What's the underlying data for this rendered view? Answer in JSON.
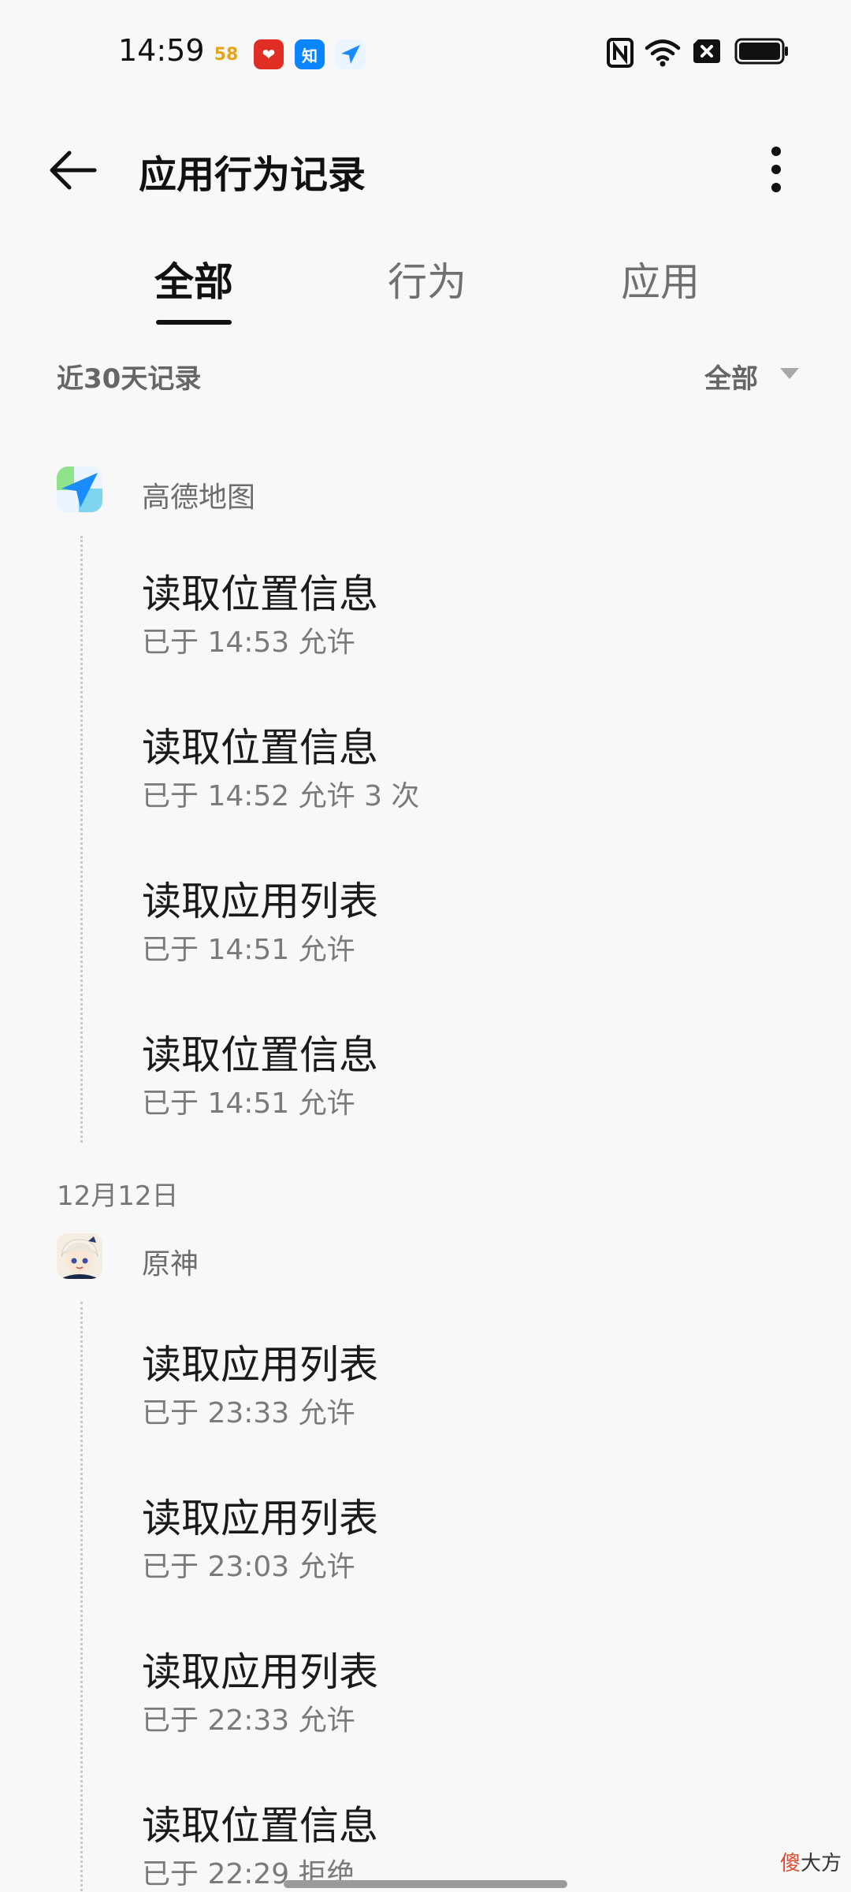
{
  "status_bar": {
    "time": "14:59",
    "notification_apps": [
      {
        "name": "58-icon",
        "glyph": "58",
        "bg": "#ffffff",
        "fg": "#e8a317"
      },
      {
        "name": "pinduoduo-icon",
        "glyph": "❤",
        "bg": "#e02e24",
        "fg": "#ffffff"
      },
      {
        "name": "zhihu-icon",
        "glyph": "知",
        "bg": "#0a84ff",
        "fg": "#ffffff"
      },
      {
        "name": "amap-icon",
        "glyph": "",
        "bg": "#eaf5ff",
        "fg": "#1a8cff"
      }
    ],
    "icons": [
      "nfc-icon",
      "wifi-icon",
      "sim-disabled-icon",
      "battery-icon"
    ]
  },
  "app_bar": {
    "title": "应用行为记录",
    "back_icon": "back-arrow-icon",
    "more_icon": "more-vertical-icon"
  },
  "tabs": [
    {
      "label": "全部",
      "active": true
    },
    {
      "label": "行为",
      "active": false
    },
    {
      "label": "应用",
      "active": false
    }
  ],
  "filter": {
    "range_label": "近30天记录",
    "dropdown_value": "全部"
  },
  "groups": [
    {
      "date": "",
      "app": {
        "name": "高德地图",
        "icon": "amap-icon"
      },
      "records": [
        {
          "action": "读取位置信息",
          "detail": "已于 14:53 允许"
        },
        {
          "action": "读取位置信息",
          "detail": "已于 14:52 允许 3 次"
        },
        {
          "action": "读取应用列表",
          "detail": "已于 14:51 允许"
        },
        {
          "action": "读取位置信息",
          "detail": "已于 14:51 允许"
        }
      ]
    },
    {
      "date": "12月12日",
      "app": {
        "name": "原神",
        "icon": "genshin-avatar-icon"
      },
      "records": [
        {
          "action": "读取应用列表",
          "detail": "已于 23:33 允许"
        },
        {
          "action": "读取应用列表",
          "detail": "已于 23:03 允许"
        },
        {
          "action": "读取应用列表",
          "detail": "已于 22:33 允许"
        },
        {
          "action": "读取位置信息",
          "detail": "已于 22:29 拒绝"
        }
      ]
    }
  ],
  "watermark": {
    "part1": "傻",
    "part2": "大方"
  },
  "colors": {
    "background": "#f8f8f8",
    "primary_text": "#1a1a1a",
    "secondary_text": "#7a7a7a",
    "amap_blue": "#1a8cff"
  }
}
